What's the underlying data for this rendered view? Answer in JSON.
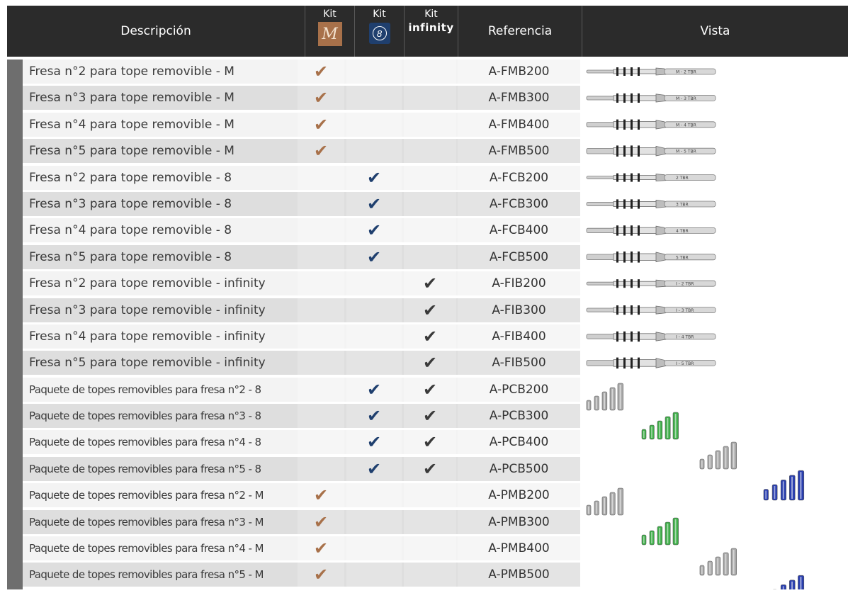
{
  "header": {
    "descripcion": "Descripción",
    "kit_m_label": "Kit",
    "kit_m_logo": "M",
    "kit_8_label": "Kit",
    "kit_8_logo": "8",
    "kit_inf_label": "Kit",
    "kit_inf_word": "infinity",
    "referencia": "Referencia",
    "vista": "Vista"
  },
  "check_symbol": "✔",
  "colors": {
    "header_bg": "#2b2b2b",
    "kit_m": "#a8714a",
    "kit_8": "#1f3f6e",
    "infinity_check": "#3a3a3a",
    "accent_bar": "#6e6e6e"
  },
  "rows": [
    {
      "desc": "Fresa n°2 para tope removible - M",
      "ref": "A-FMB200",
      "m": true,
      "b8": false,
      "inf": false
    },
    {
      "desc": "Fresa n°3 para tope removible - M",
      "ref": "A-FMB300",
      "m": true,
      "b8": false,
      "inf": false
    },
    {
      "desc": "Fresa n°4 para tope removible - M",
      "ref": "A-FMB400",
      "m": true,
      "b8": false,
      "inf": false
    },
    {
      "desc": "Fresa n°5 para tope removible - M",
      "ref": "A-FMB500",
      "m": true,
      "b8": false,
      "inf": false
    },
    {
      "desc": "Fresa n°2 para tope removible - 8",
      "ref": "A-FCB200",
      "m": false,
      "b8": true,
      "inf": false
    },
    {
      "desc": "Fresa n°3 para tope removible - 8",
      "ref": "A-FCB300",
      "m": false,
      "b8": true,
      "inf": false
    },
    {
      "desc": "Fresa n°4 para tope removible - 8",
      "ref": "A-FCB400",
      "m": false,
      "b8": true,
      "inf": false
    },
    {
      "desc": "Fresa n°5 para tope removible - 8",
      "ref": "A-FCB500",
      "m": false,
      "b8": true,
      "inf": false
    },
    {
      "desc": "Fresa n°2 para tope removible - infinity",
      "ref": "A-FIB200",
      "m": false,
      "b8": false,
      "inf": true
    },
    {
      "desc": "Fresa n°3 para tope removible - infinity",
      "ref": "A-FIB300",
      "m": false,
      "b8": false,
      "inf": true
    },
    {
      "desc": "Fresa n°4 para tope removible - infinity",
      "ref": "A-FIB400",
      "m": false,
      "b8": false,
      "inf": true
    },
    {
      "desc": "Fresa n°5 para tope removible - infinity",
      "ref": "A-FIB500",
      "m": false,
      "b8": false,
      "inf": true
    },
    {
      "desc": "Paquete de topes removibles para fresa n°2 - 8",
      "ref": "A-PCB200",
      "m": false,
      "b8": true,
      "inf": true
    },
    {
      "desc": "Paquete de topes removibles para fresa n°3 - 8",
      "ref": "A-PCB300",
      "m": false,
      "b8": true,
      "inf": true
    },
    {
      "desc": "Paquete de topes removibles para fresa n°4 - 8",
      "ref": "A-PCB400",
      "m": false,
      "b8": true,
      "inf": true
    },
    {
      "desc": "Paquete de topes removibles para fresa n°5 - 8",
      "ref": "A-PCB500",
      "m": false,
      "b8": true,
      "inf": true
    },
    {
      "desc": "Paquete de topes removibles para fresa n°2 - M",
      "ref": "A-PMB200",
      "m": true,
      "b8": false,
      "inf": false
    },
    {
      "desc": "Paquete de topes removibles para fresa n°3 - M",
      "ref": "A-PMB300",
      "m": true,
      "b8": false,
      "inf": false
    },
    {
      "desc": "Paquete de topes removibles para fresa n°4 - M",
      "ref": "A-PMB400",
      "m": true,
      "b8": false,
      "inf": false
    },
    {
      "desc": "Paquete de topes removibles para fresa n°5 - M",
      "ref": "A-PMB500",
      "m": true,
      "b8": false,
      "inf": false
    }
  ],
  "drill_labels": [
    "M - 2 TBR",
    "M - 3 TBR",
    "M - 4 TBR",
    "M - 5 TBR",
    "2 TBR",
    "3 TBR",
    "4 TBR",
    "5 TBR",
    "I - 2 TBR",
    "I - 3 TBR",
    "I - 4 TBR",
    "I - 5 TBR"
  ],
  "stop_colors": [
    "#a9a9a9",
    "#3fae49",
    "#a9a9a9",
    "#2a3fb0"
  ]
}
